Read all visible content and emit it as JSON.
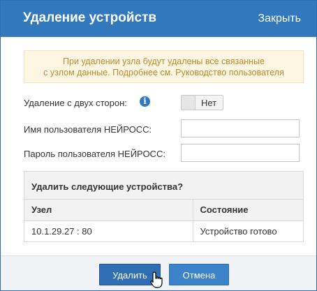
{
  "dialog": {
    "title": "Удаление устройств",
    "close_label": "Закрыть"
  },
  "notice": {
    "line1": "При удалении узла будут удалены все связанные",
    "line2": "с узлом данные. Подробнее см. Руководство пользователя"
  },
  "form": {
    "two_sided_label": "Удаление с двух сторон:",
    "two_sided_value": "Нет",
    "username_label": "Имя пользователя НЕЙРОСС:",
    "username_value": "",
    "password_label": "Пароль пользователя НЕЙРОСС:",
    "password_value": ""
  },
  "devices": {
    "heading": "Удалить следующие устройства?",
    "columns": [
      "Узел",
      "Состояние"
    ],
    "rows": [
      {
        "node": "10.1.29.27 : 80",
        "status": "Устройство готово"
      }
    ]
  },
  "footer": {
    "delete_label": "Удалить",
    "cancel_label": "Отмена"
  },
  "icons": {
    "info": "info-icon",
    "cursor": "hand-pointer-icon"
  },
  "colors": {
    "header_bg": "#3178bd",
    "notice_bg": "#fcf6e3",
    "notice_text": "#bd8b2c",
    "button_primary": "#2e6fb3"
  }
}
